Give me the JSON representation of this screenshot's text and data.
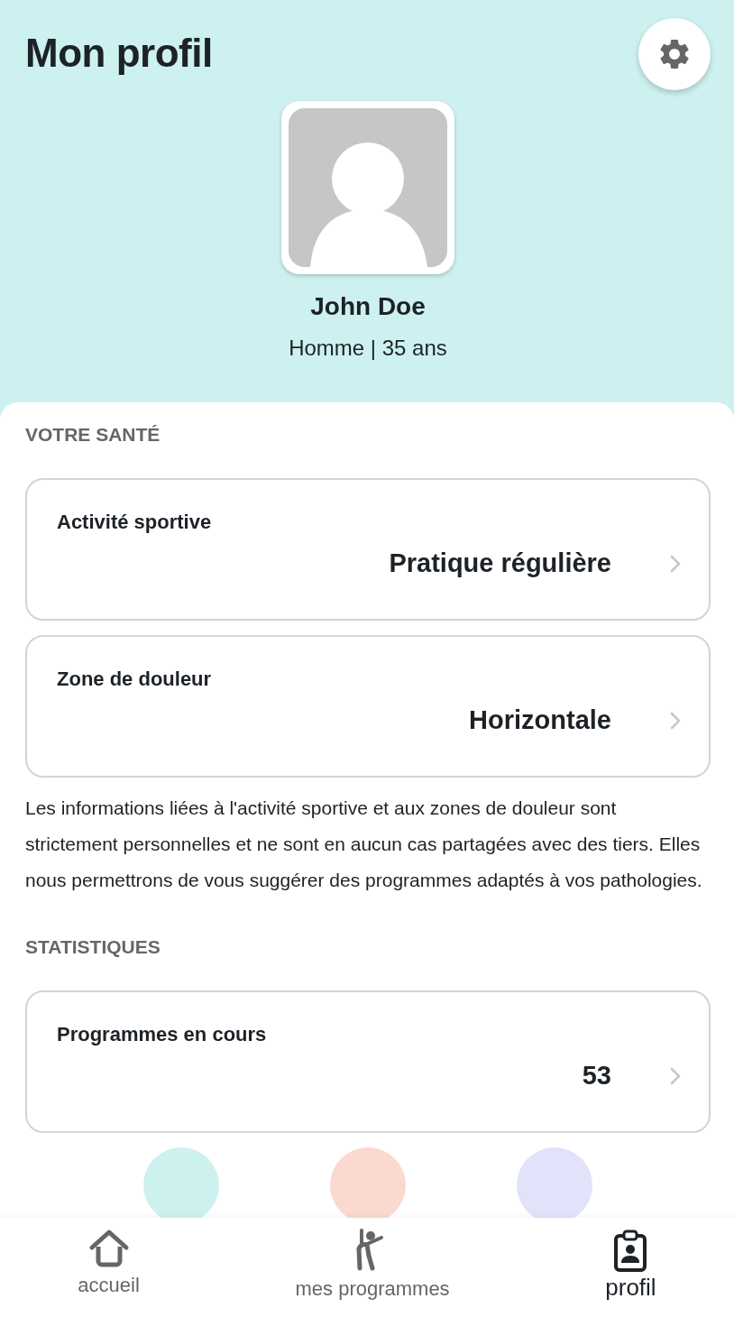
{
  "header": {
    "title": "Mon profil",
    "name": "John Doe",
    "details": "Homme | 35 ans"
  },
  "sections": [
    {
      "heading": "VOTRE SANTÉ",
      "cards": [
        {
          "label": "Activité sportive",
          "value": "Pratique régulière"
        },
        {
          "label": "Zone de douleur",
          "value": "Horizontale"
        }
      ],
      "note": "Les informations liées à l'activité sportive et aux zones de douleur sont strictement personnelles et ne sont en aucun cas partagées avec des tiers. Elles nous permettrons de vous suggérer des programmes adaptés à vos pathologies."
    },
    {
      "heading": "STATISTIQUES",
      "cards": [
        {
          "label": "Programmes en cours",
          "value": "53"
        }
      ],
      "peeks": [
        {
          "color": "#cdf1ee"
        },
        {
          "color": "#fbd9cf"
        },
        {
          "color": "#e2e2fb"
        }
      ]
    }
  ],
  "nav": [
    {
      "kind": "home",
      "label": "accueil",
      "selected": false
    },
    {
      "kind": "exercise",
      "label": "mes programmes",
      "selected": false
    },
    {
      "kind": "profile",
      "label": "profil",
      "selected": true
    }
  ]
}
